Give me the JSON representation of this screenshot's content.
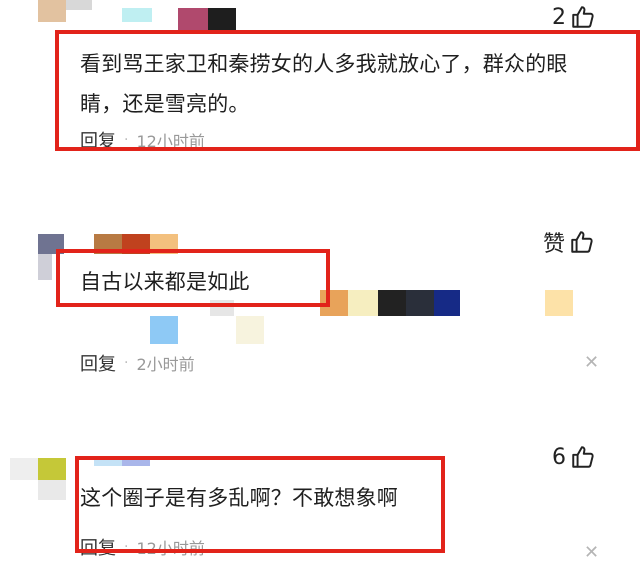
{
  "comments": [
    {
      "like_count": "2",
      "text": "看到骂王家卫和秦捞女的人多我就放心了，群众的眼睛，还是雪亮的。",
      "reply_label": "回复",
      "separator": "·",
      "time": "12小时前"
    },
    {
      "like_count": "赞",
      "text": "自古以来都是如此",
      "reply_label": "回复",
      "separator": "·",
      "time": "2小时前"
    },
    {
      "like_count": "6",
      "text": "这个圈子是有多乱啊？不敢想象啊",
      "reply_label": "回复",
      "separator": "·",
      "time": "12小时前"
    }
  ],
  "icons": {
    "like": "thumbs-up-icon",
    "close": "close-icon"
  },
  "colors": {
    "highlight_border": "#e2231a",
    "meta_text": "#999999"
  }
}
